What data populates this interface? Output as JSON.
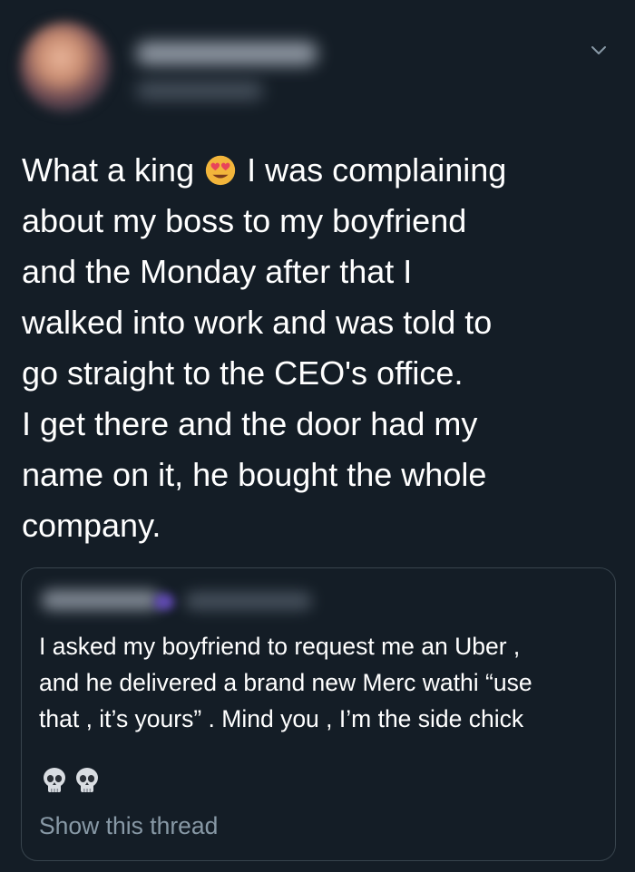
{
  "tweet": {
    "lines": [
      "What a king",
      "I was complaining",
      "about my boss to my boyfriend",
      "and the Monday after that I",
      "walked into work and was told to",
      "go straight to the CEO's office.",
      "I get there and the door had my",
      "name on it, he bought the whole",
      "company."
    ],
    "emoji_name": "heart-eyes-emoji"
  },
  "quote": {
    "lines": [
      "I asked my boyfriend to request me an Uber ,",
      "and he delivered a brand new Merc wathi “use",
      "that , it’s yours” . Mind you , I’m the side chick"
    ],
    "reaction_emoji": [
      "skull-emoji",
      "skull-emoji"
    ],
    "show_thread_label": "Show this thread"
  },
  "colors": {
    "background": "#141d26",
    "border": "#38444d",
    "secondary_text": "#8899a6",
    "text": "#ffffff"
  }
}
